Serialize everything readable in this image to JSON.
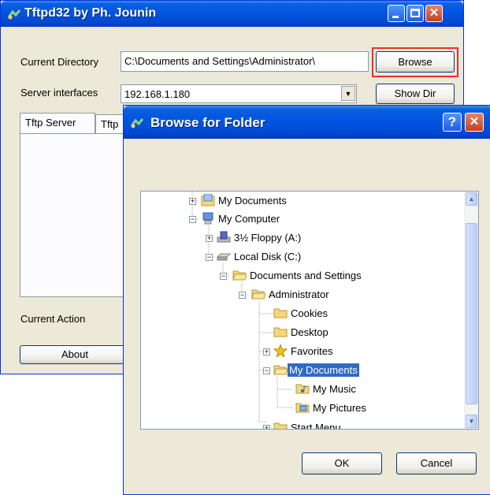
{
  "main_window": {
    "title": "Tftpd32 by Ph. Jounin",
    "current_directory_label": "Current Directory",
    "current_directory_value": "C:\\Documents and Settings\\Administrator\\",
    "browse_label": "Browse",
    "server_interfaces_label": "Server interfaces",
    "server_interface_value": "192.168.1.180",
    "show_dir_label": "Show Dir",
    "tabs": [
      "Tftp Server",
      "Tftp"
    ],
    "current_action_label": "Current Action",
    "about_label": "About"
  },
  "dialog": {
    "title": "Browse for Folder",
    "help_icon": "?",
    "ok_label": "OK",
    "cancel_label": "Cancel",
    "tree": [
      {
        "label": "My Documents",
        "icon": "my-documents-icon"
      },
      {
        "label": "My Computer",
        "icon": "my-computer-icon"
      },
      {
        "label": "3½ Floppy (A:)",
        "icon": "floppy-drive-icon"
      },
      {
        "label": "Local Disk (C:)",
        "icon": "hard-disk-icon"
      },
      {
        "label": "Documents and Settings",
        "icon": "folder-icon"
      },
      {
        "label": "Administrator",
        "icon": "folder-icon"
      },
      {
        "label": "Cookies",
        "icon": "folder-icon"
      },
      {
        "label": "Desktop",
        "icon": "folder-icon"
      },
      {
        "label": "Favorites",
        "icon": "favorites-star-icon"
      },
      {
        "label": "My Documents",
        "icon": "folder-icon",
        "selected": true
      },
      {
        "label": "My Music",
        "icon": "music-folder-icon"
      },
      {
        "label": "My Pictures",
        "icon": "pictures-folder-icon"
      },
      {
        "label": "Start Menu",
        "icon": "folder-icon"
      }
    ]
  },
  "colors": {
    "titlebar": "#0054e3",
    "selection": "#316ac5",
    "window_face": "#ece9d8",
    "highlight_box": "#e8302a"
  }
}
